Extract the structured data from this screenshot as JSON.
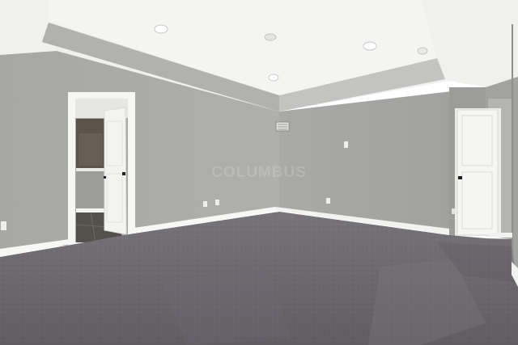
{
  "photo": {
    "subject": "empty-bedroom-interior",
    "watermark_text": "COLUMBUS",
    "colors": {
      "wall": "#a9a9a7",
      "ceiling": "#f3f3f2",
      "trim": "#f7f7f6",
      "carpet": "#6a6769",
      "door": "#f4f4f3"
    },
    "icons": [
      "recessed-light-icon",
      "hvac-vent-icon",
      "door-handle-icon",
      "outlet-icon"
    ]
  }
}
